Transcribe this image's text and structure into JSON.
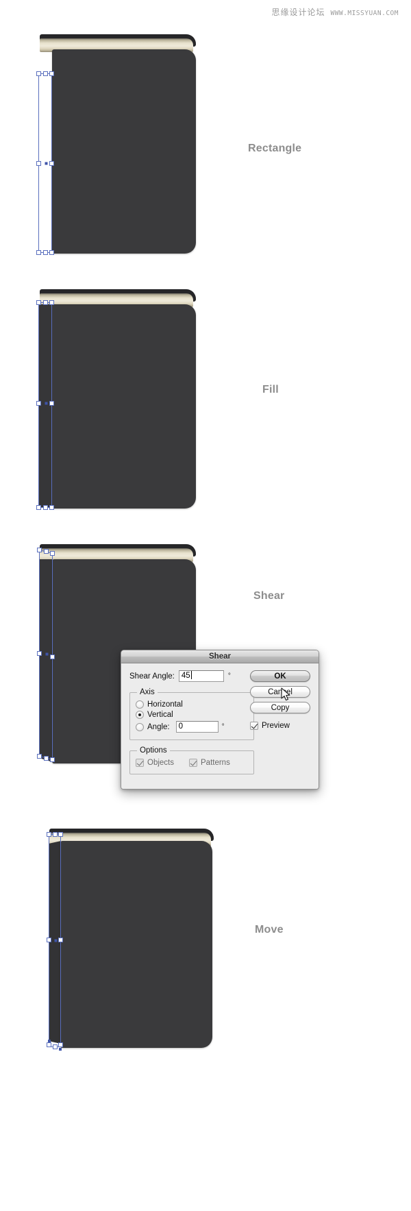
{
  "watermark": {
    "cn_text": "思缘设计论坛",
    "url_text": "WWW.MISSYUAN.COM"
  },
  "steps": [
    {
      "label": "Rectangle"
    },
    {
      "label": "Fill"
    },
    {
      "label": "Shear"
    },
    {
      "label": "Move"
    }
  ],
  "dialog": {
    "title": "Shear",
    "shear_angle": {
      "label": "Shear Angle:",
      "value": "45",
      "unit": "°"
    },
    "axis": {
      "legend": "Axis",
      "options": [
        {
          "label": "Horizontal",
          "selected": false
        },
        {
          "label": "Vertical",
          "selected": true
        },
        {
          "label": "Angle:",
          "selected": false
        }
      ],
      "angle_value": "0",
      "angle_unit": "°"
    },
    "options": {
      "legend": "Options",
      "checkboxes": [
        {
          "label": "Objects",
          "checked": true
        },
        {
          "label": "Patterns",
          "checked": true
        }
      ]
    },
    "buttons": [
      {
        "label": "OK",
        "default": true
      },
      {
        "label": "Cancel",
        "default": false
      },
      {
        "label": "Copy",
        "default": false
      }
    ],
    "preview": {
      "label": "Preview",
      "checked": true
    }
  },
  "colors": {
    "cover": "#3a3a3c",
    "cover_back": "#262628",
    "pages_light": "#efeada",
    "pages_dark": "#8c8571",
    "selection_blue": "#5a6fbe",
    "anchor_fill": "#ffffff",
    "label_gray": "#8d8d8d",
    "watermark_gray": "#9b9b9b",
    "dialog_bg": "#ececec"
  }
}
